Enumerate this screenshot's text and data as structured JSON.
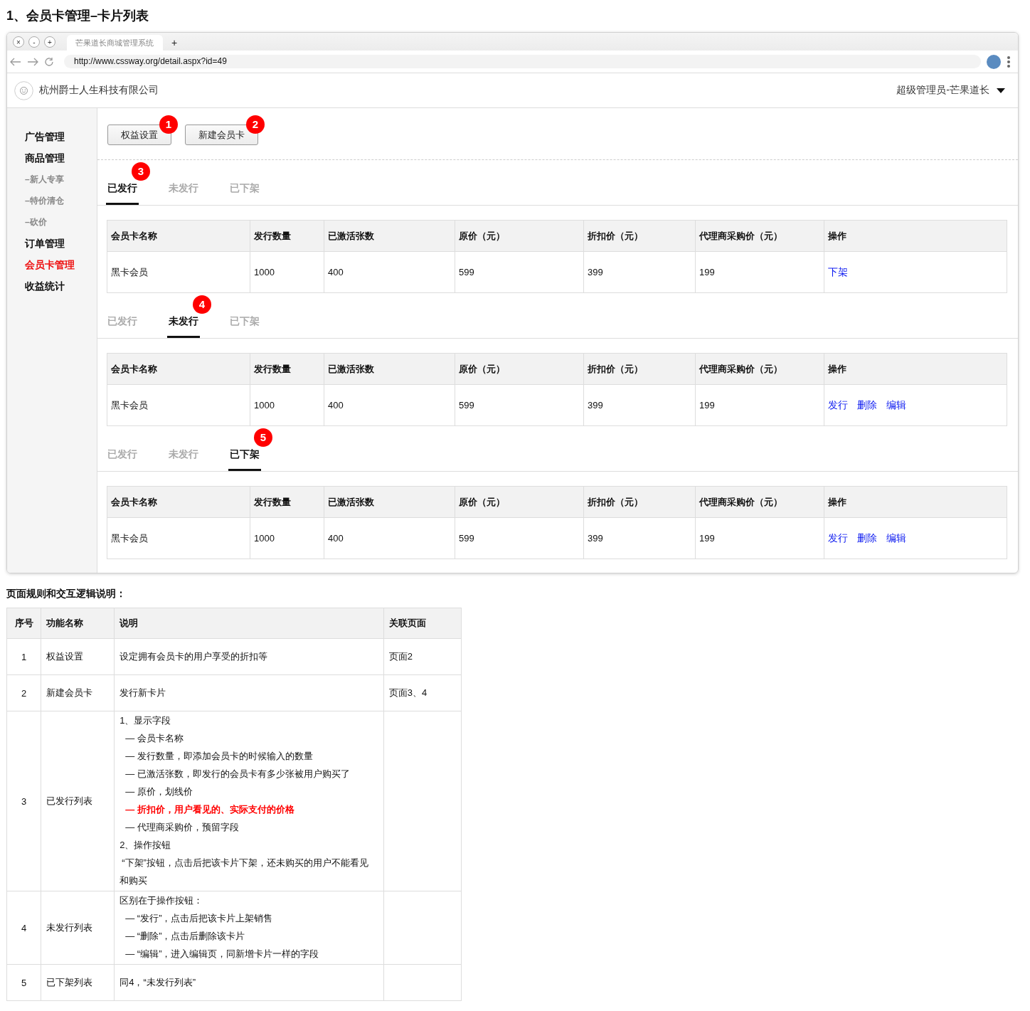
{
  "heading": "1、会员卡管理–卡片列表",
  "browser": {
    "window_controls": [
      "×",
      "-",
      "+"
    ],
    "tab_title": "芒果道长商城管理系统",
    "new_tab": "+",
    "url": "http://www.cssway.org/detail.aspx?id=49"
  },
  "app_header": {
    "company": "杭州爵士人生科技有限公司",
    "user": "超级管理员-芒果道长"
  },
  "sidebar": {
    "items": [
      {
        "label": "广告管理",
        "kind": "main",
        "selected": false
      },
      {
        "label": "商品管理",
        "kind": "main",
        "selected": false
      },
      {
        "label": "–新人专享",
        "kind": "sub",
        "selected": false
      },
      {
        "label": "–特价清仓",
        "kind": "sub",
        "selected": false
      },
      {
        "label": "–砍价",
        "kind": "sub",
        "selected": false
      },
      {
        "label": "订单管理",
        "kind": "main",
        "selected": false
      },
      {
        "label": "会员卡管理",
        "kind": "main",
        "selected": true
      },
      {
        "label": "收益统计",
        "kind": "main",
        "selected": false
      }
    ]
  },
  "buttons": [
    {
      "label": "权益设置",
      "badge": "1"
    },
    {
      "label": "新建会员卡",
      "badge": "2"
    }
  ],
  "sections": [
    {
      "badge": "3",
      "tabs": [
        {
          "label": "已发行",
          "selected": true
        },
        {
          "label": "未发行",
          "selected": false
        },
        {
          "label": "已下架",
          "selected": false
        }
      ],
      "table": {
        "columns": [
          "会员卡名称",
          "发行数量",
          "已激活张数",
          "原价（元）",
          "折扣价（元）",
          "代理商采购价（元）",
          "操作"
        ],
        "rows": [
          {
            "cells": [
              "黑卡会员",
              "1000",
              "400",
              "599",
              "399",
              "199"
            ],
            "actions": [
              "下架"
            ]
          }
        ]
      }
    },
    {
      "badge": "4",
      "tabs": [
        {
          "label": "已发行",
          "selected": false
        },
        {
          "label": "未发行",
          "selected": true
        },
        {
          "label": "已下架",
          "selected": false
        }
      ],
      "table": {
        "columns": [
          "会员卡名称",
          "发行数量",
          "已激活张数",
          "原价（元）",
          "折扣价（元）",
          "代理商采购价（元）",
          "操作"
        ],
        "rows": [
          {
            "cells": [
              "黑卡会员",
              "1000",
              "400",
              "599",
              "399",
              "199"
            ],
            "actions": [
              "发行",
              "删除",
              "编辑"
            ]
          }
        ]
      }
    },
    {
      "badge": "5",
      "tabs": [
        {
          "label": "已发行",
          "selected": false
        },
        {
          "label": "未发行",
          "selected": false
        },
        {
          "label": "已下架",
          "selected": true
        }
      ],
      "table": {
        "columns": [
          "会员卡名称",
          "发行数量",
          "已激活张数",
          "原价（元）",
          "折扣价（元）",
          "代理商采购价（元）",
          "操作"
        ],
        "rows": [
          {
            "cells": [
              "黑卡会员",
              "1000",
              "400",
              "599",
              "399",
              "199"
            ],
            "actions": [
              "发行",
              "删除",
              "编辑"
            ]
          }
        ]
      }
    }
  ],
  "notes": {
    "title": "页面规则和交互逻辑说明：",
    "columns": [
      "序号",
      "功能名称",
      "说明",
      "关联页面"
    ],
    "rows": [
      {
        "number": "1",
        "name": "权益设置",
        "description": [
          {
            "kind": "text",
            "text": "设定拥有会员卡的用户享受的折扣等"
          }
        ],
        "page": "页面2"
      },
      {
        "number": "2",
        "name": "新建会员卡",
        "description": [
          {
            "kind": "text",
            "text": "发行新卡片"
          }
        ],
        "page": "页面3、4"
      },
      {
        "number": "3",
        "name": "已发行列表",
        "description": [
          {
            "kind": "text",
            "text": "1、显示字段"
          },
          {
            "kind": "item",
            "text": "— 会员卡名称"
          },
          {
            "kind": "item",
            "text": "— 发行数量，即添加会员卡的时候输入的数量"
          },
          {
            "kind": "item",
            "text": "— 已激活张数，即发行的会员卡有多少张被用户购买了"
          },
          {
            "kind": "item",
            "text": "— 原价，划线价"
          },
          {
            "kind": "highlight",
            "text": "— 折扣价，用户看见的、实际支付的价格"
          },
          {
            "kind": "item",
            "text": "— 代理商采购价，预留字段"
          },
          {
            "kind": "text",
            "text": "2、操作按钮"
          },
          {
            "kind": "para",
            "text": "“下架”按钮，点击后把该卡片下架，还未购买的用户不能看见和购买"
          }
        ]
      },
      {
        "number": "4",
        "name": "未发行列表",
        "description": [
          {
            "kind": "text",
            "text": "区别在于操作按钮："
          },
          {
            "kind": "item",
            "text": "— “发行”，点击后把该卡片上架销售"
          },
          {
            "kind": "item",
            "text": "— “删除”，点击后删除该卡片"
          },
          {
            "kind": "item",
            "text": "— “编辑”，进入编辑页，同新增卡片一样的字段"
          }
        ]
      },
      {
        "number": "5",
        "name": "已下架列表",
        "description": [
          {
            "kind": "text",
            "text": "同4，“未发行列表”"
          }
        ]
      }
    ]
  }
}
